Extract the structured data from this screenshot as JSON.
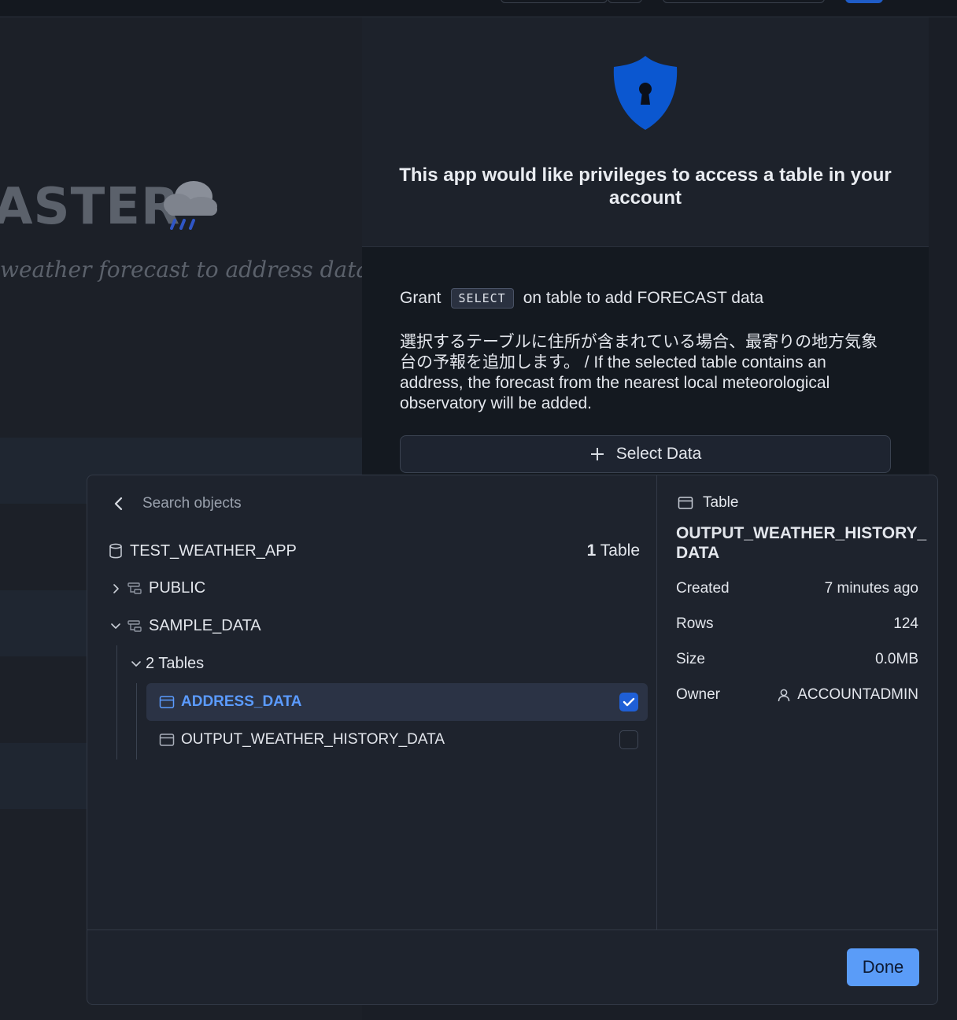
{
  "background": {
    "title_fragment": "ASTER",
    "subtitle_fragment": "weather forecast to address data fr"
  },
  "permission": {
    "heading": "This app would like privileges to access a table in your account",
    "grant_prefix": "Grant",
    "privilege": "SELECT",
    "grant_suffix": "on table to add FORECAST data",
    "description": "選択するテーブルに住所が含まれている場合、最寄りの地方気象台の予報を追加します。 / If the selected table contains an address, the forecast from the nearest local meteorological observatory will be added.",
    "select_data_label": "Select Data",
    "accent_color": "#0b57d0"
  },
  "picker": {
    "search_placeholder": "Search objects",
    "search_value": "",
    "database": {
      "name": "TEST_WEATHER_APP",
      "count_number": "1",
      "count_label": "Table"
    },
    "schemas": [
      {
        "name": "PUBLIC",
        "expanded": false
      },
      {
        "name": "SAMPLE_DATA",
        "expanded": true
      }
    ],
    "tables_group_label": "2 Tables",
    "tables": [
      {
        "name": "ADDRESS_DATA",
        "checked": true
      },
      {
        "name": "OUTPUT_WEATHER_HISTORY_DATA",
        "checked": false
      }
    ],
    "detail": {
      "type_label": "Table",
      "name": "OUTPUT_WEATHER_HISTORY_DATA",
      "rows": [
        {
          "key": "Created",
          "value": "7 minutes ago"
        },
        {
          "key": "Rows",
          "value": "124"
        },
        {
          "key": "Size",
          "value": "0.0MB"
        },
        {
          "key": "Owner",
          "value": "ACCOUNTADMIN"
        }
      ]
    },
    "done_label": "Done"
  }
}
